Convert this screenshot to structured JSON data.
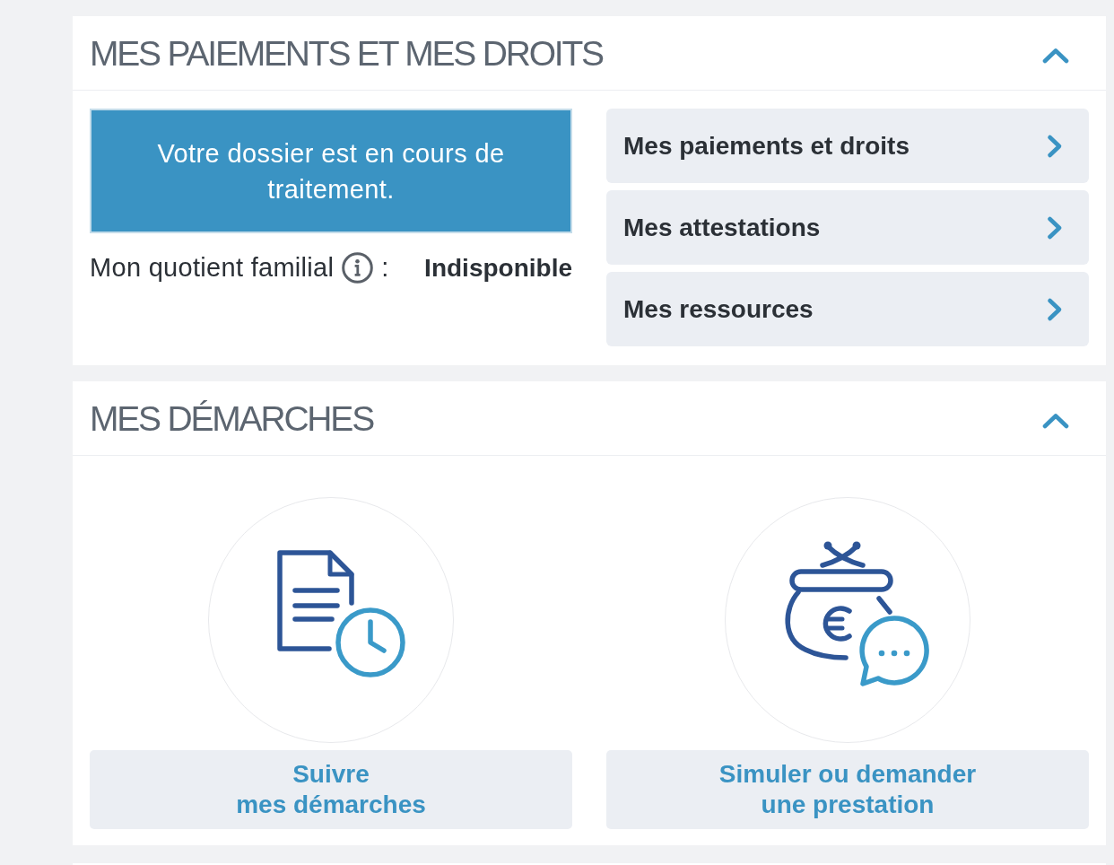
{
  "sections": [
    {
      "kind": "rights",
      "title": "MES PAIEMENTS ET MES DROITS",
      "expanded": true,
      "status_message": "Votre dossier est en cours de traitement.",
      "quotient": {
        "label": "Mon quotient familial",
        "separator": ":",
        "value": "Indisponible"
      },
      "links": [
        {
          "label": "Mes paiements et droits"
        },
        {
          "label": "Mes attestations"
        },
        {
          "label": "Mes ressources"
        }
      ]
    },
    {
      "kind": "procedures",
      "title": "MES DÉMARCHES",
      "expanded": true,
      "actions": [
        {
          "kind": "tracking",
          "label_lines": [
            "Suivre",
            "mes démarches"
          ]
        },
        {
          "kind": "simulation",
          "label_lines": [
            "Simuler ou demander",
            "une prestation"
          ]
        }
      ]
    }
  ]
}
